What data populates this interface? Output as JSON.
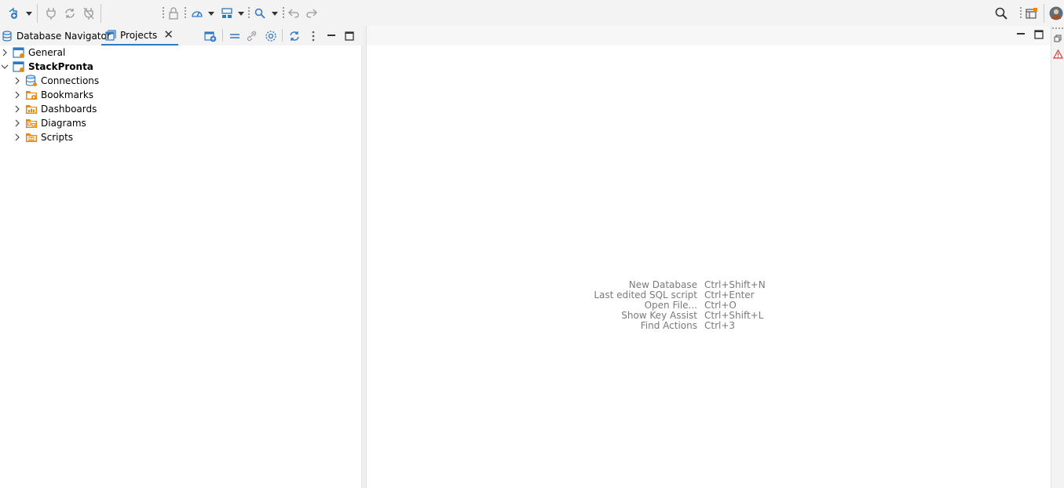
{
  "toolbar": {
    "icons": [
      "new-connection-icon",
      "connect-icon",
      "reconnect-icon",
      "disconnect-icon",
      "lock-icon",
      "database-icon",
      "transaction-icon",
      "search-icon",
      "back-icon",
      "forward-icon",
      "global-search-icon",
      "perspective-icon",
      "account-avatar-icon"
    ]
  },
  "left_panel": {
    "tabs": [
      {
        "label": "Database Navigator",
        "active": false
      },
      {
        "label": "Projects",
        "active": true
      }
    ],
    "tree": {
      "general": {
        "label": "General",
        "expanded": false
      },
      "project": {
        "label": "StackPronta",
        "expanded": true,
        "children": [
          {
            "label": "Connections",
            "icon": "connections-icon"
          },
          {
            "label": "Bookmarks",
            "icon": "bookmarks-folder-icon"
          },
          {
            "label": "Dashboards",
            "icon": "dashboards-folder-icon"
          },
          {
            "label": "Diagrams",
            "icon": "diagrams-folder-icon"
          },
          {
            "label": "Scripts",
            "icon": "scripts-folder-icon"
          }
        ]
      }
    }
  },
  "editor": {
    "shortcuts": [
      {
        "command": "New Database",
        "keys": "Ctrl+Shift+N"
      },
      {
        "command": "Last edited SQL script",
        "keys": "Ctrl+Enter"
      },
      {
        "command": "Open File...",
        "keys": "Ctrl+O"
      },
      {
        "command": "Show Key Assist",
        "keys": "Ctrl+Shift+L"
      },
      {
        "command": "Find Actions",
        "keys": "Ctrl+3"
      }
    ]
  },
  "colors": {
    "accent_blue": "#2f78c4",
    "folder_orange": "#e8890c",
    "shortcut_gray": "#7a7a7a",
    "warning_red": "#d9352b"
  }
}
